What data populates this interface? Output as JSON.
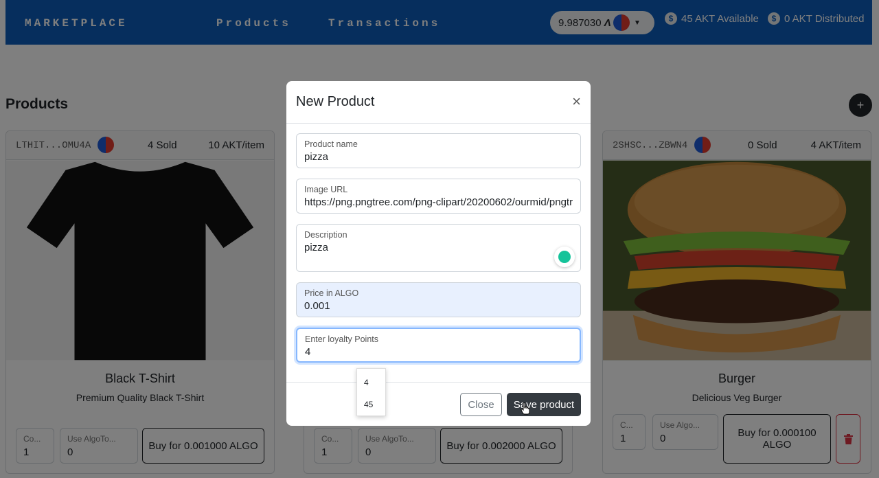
{
  "navbar": {
    "brand": "MARKETPLACE",
    "links": [
      "Products",
      "Transactions"
    ],
    "wallet_balance": "9.987030",
    "wallet_unit": "Ʌ",
    "akt_available": "45 AKT Available",
    "akt_distributed": "0 AKT Distributed",
    "coin_icon_glyph": "$"
  },
  "page": {
    "title": "Products",
    "add_button": "+"
  },
  "products": [
    {
      "address": "LTHIT...OMU4A",
      "sold": "4 Sold",
      "price": "10 AKT/item",
      "title": "Black T-Shirt",
      "description": "Premium Quality Black T-Shirt",
      "count_label": "Co...",
      "count_value": "1",
      "token_label": "Use AlgoTo...",
      "token_value": "0",
      "buy_label": "Buy for 0.001000 ALGO"
    },
    {
      "address": "",
      "sold": "",
      "price": "",
      "title": "",
      "description": "",
      "count_label": "Co...",
      "count_value": "1",
      "token_label": "Use AlgoTo...",
      "token_value": "0",
      "buy_label": "Buy for 0.002000 ALGO"
    },
    {
      "address": "2SHSC...ZBWN4",
      "sold": "0 Sold",
      "price": "4 AKT/item",
      "title": "Burger",
      "description": "Delicious Veg Burger",
      "count_label": "C...",
      "count_value": "1",
      "token_label": "Use Algo...",
      "token_value": "0",
      "buy_label": "Buy for 0.000100 ALGO"
    }
  ],
  "modal": {
    "title": "New Product",
    "close_glyph": "×",
    "fields": [
      {
        "label": "Product name",
        "value": "pizza"
      },
      {
        "label": "Image URL",
        "value": "https://png.pngtree.com/png-clipart/20200602/ourmid/pngtr"
      },
      {
        "label": "Description",
        "value": "pizza"
      },
      {
        "label": "Price in ALGO",
        "value": "0.001"
      },
      {
        "label": "Enter loyalty Points",
        "value": "4"
      }
    ],
    "autocomplete_options": [
      "4",
      "45"
    ],
    "close_button": "Close",
    "save_button": "Save product"
  },
  "colors": {
    "navbar": "#0d5dbb",
    "primary_dark": "#343a40",
    "danger": "#dc3545"
  }
}
